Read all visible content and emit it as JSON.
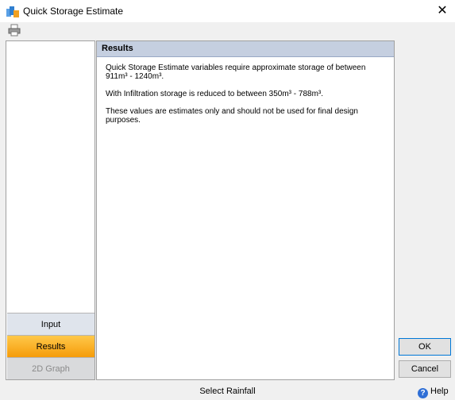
{
  "window": {
    "title": "Quick Storage Estimate",
    "close_glyph": "✕"
  },
  "icons": {
    "app": "app-icon",
    "print": "print-icon",
    "help": "help-icon"
  },
  "nav": {
    "input": "Input",
    "results": "Results",
    "graph": "2D Graph",
    "active": "Results",
    "active_color": "#f5a623"
  },
  "panel": {
    "header": "Results",
    "paragraphs": [
      "Quick Storage Estimate variables require approximate storage of between 911m³ - 1240m³.",
      "With Infiltration storage is reduced to between 350m³ - 788m³.",
      "These values are estimates only and should not be used for final design purposes."
    ]
  },
  "buttons": {
    "ok": "OK",
    "cancel": "Cancel"
  },
  "status": {
    "text": "Select Rainfall",
    "help_label": "Help",
    "help_glyph": "?"
  }
}
